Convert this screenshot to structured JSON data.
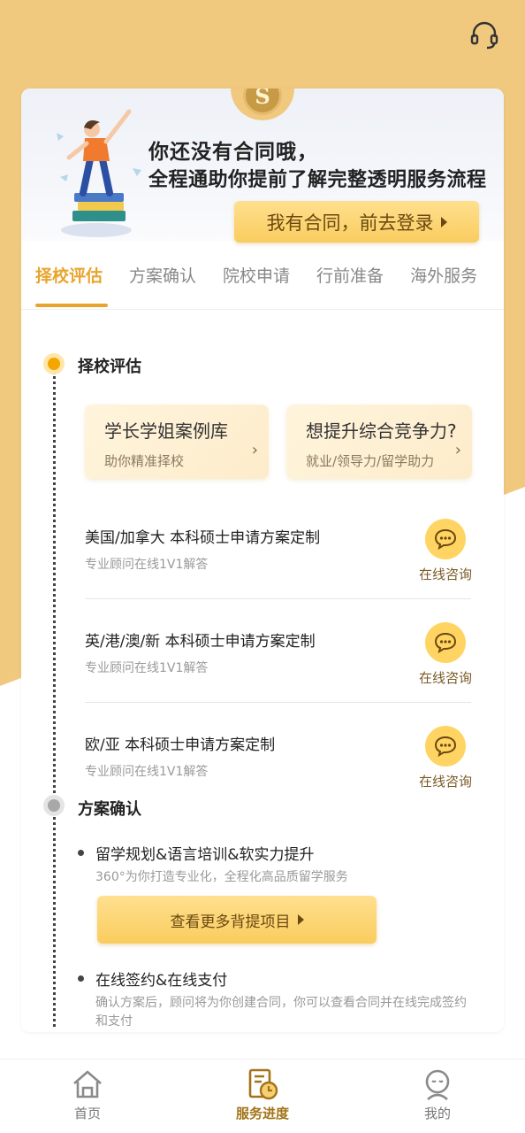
{
  "banner": {
    "line1": "你还没有合同哦，",
    "line2": "全程通助你提前了解完整透明服务流程",
    "login_button": "我有合同，前去登录",
    "logo_letter": "S"
  },
  "tabs": [
    "择校评估",
    "方案确认",
    "院校申请",
    "行前准备",
    "海外服务"
  ],
  "active_tab": "择校评估",
  "section1": {
    "title": "择校评估",
    "features": [
      {
        "title": "学长学姐案例库",
        "sub": "助你精准择校"
      },
      {
        "title": "想提升综合竞争力?",
        "sub": "就业/领导力/留学助力"
      }
    ],
    "items": [
      {
        "title": "美国/加拿大 本科硕士申请方案定制",
        "sub": "专业顾问在线1V1解答",
        "action": "在线咨询"
      },
      {
        "title": "英/港/澳/新 本科硕士申请方案定制",
        "sub": "专业顾问在线1V1解答",
        "action": "在线咨询"
      },
      {
        "title": "欧/亚 本科硕士申请方案定制",
        "sub": "专业顾问在线1V1解答",
        "action": "在线咨询"
      }
    ]
  },
  "section2": {
    "title": "方案确认",
    "bullets": [
      {
        "title": "留学规划&语言培训&软实力提升",
        "sub": "360°为你打造专业化，全程化高品质留学服务"
      },
      {
        "title": "在线签约&在线支付",
        "sub": "确认方案后，顾问将为你创建合同，你可以查看合同并在线完成签约和支付"
      }
    ],
    "more_button": "查看更多背提项目"
  },
  "bottom_nav": [
    {
      "label": "首页",
      "icon": "home-icon"
    },
    {
      "label": "服务进度",
      "icon": "progress-icon"
    },
    {
      "label": "我的",
      "icon": "profile-icon"
    }
  ],
  "colors": {
    "accent": "#e8a52e",
    "background_top": "#f0c97f",
    "button": "#f9cc5e"
  }
}
